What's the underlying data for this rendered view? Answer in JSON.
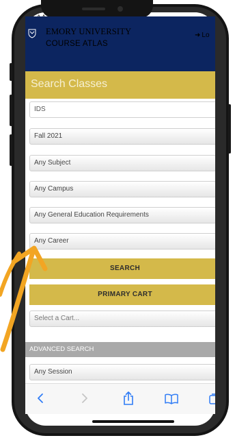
{
  "status_bar": {
    "left_text": "AA"
  },
  "header": {
    "university": "EMORY UNIVERSITY",
    "product": "COURSE ATLAS",
    "login_label": "Lo"
  },
  "search": {
    "title": "Search Classes"
  },
  "fields": {
    "keyword_value": "IDS",
    "term": "Fall 2021",
    "subject": "Any Subject",
    "campus": "Any Campus",
    "ger": "Any General Education Requirements",
    "career": "Any Career"
  },
  "buttons": {
    "search_label": "SEARCH",
    "primary_cart_label": "PRIMARY CART"
  },
  "cart": {
    "placeholder": "Select a Cart..."
  },
  "advanced": {
    "section_label": "ADVANCED SEARCH",
    "session": "Any Session"
  },
  "browser": {
    "icons": [
      "back-icon",
      "forward-icon",
      "share-icon",
      "bookmarks-icon",
      "tabs-icon"
    ]
  },
  "colors": {
    "navy": "#0c2560",
    "gold": "#d4b94a",
    "annotation_arrow": "#f2a523",
    "advanced_bar": "#a9a9a9"
  }
}
